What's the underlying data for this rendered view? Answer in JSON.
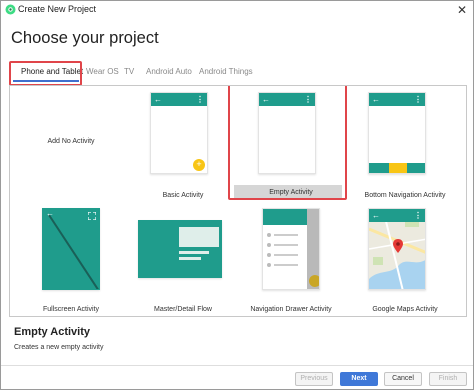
{
  "window": {
    "title": "Create New Project"
  },
  "heading": "Choose your project",
  "tabs": [
    {
      "label": "Phone and Tablet",
      "active": true
    },
    {
      "label": "Wear OS",
      "active": false
    },
    {
      "label": "TV",
      "active": false
    },
    {
      "label": "Android Auto",
      "active": false
    },
    {
      "label": "Android Things",
      "active": false
    }
  ],
  "templates": [
    {
      "label": "Add No Activity"
    },
    {
      "label": "Basic Activity"
    },
    {
      "label": "Empty Activity",
      "selected": true
    },
    {
      "label": "Bottom Navigation Activity"
    },
    {
      "label": "Fullscreen Activity"
    },
    {
      "label": "Master/Detail Flow"
    },
    {
      "label": "Navigation Drawer Activity"
    },
    {
      "label": "Google Maps Activity"
    }
  ],
  "description": {
    "title": "Empty Activity",
    "text": "Creates a new empty activity"
  },
  "buttons": {
    "previous": "Previous",
    "next": "Next",
    "cancel": "Cancel",
    "finish": "Finish"
  },
  "colors": {
    "accent": "#1f9c8c",
    "fab": "#f8c515",
    "highlight": "#e0454a",
    "primary_button": "#3f78d8"
  }
}
